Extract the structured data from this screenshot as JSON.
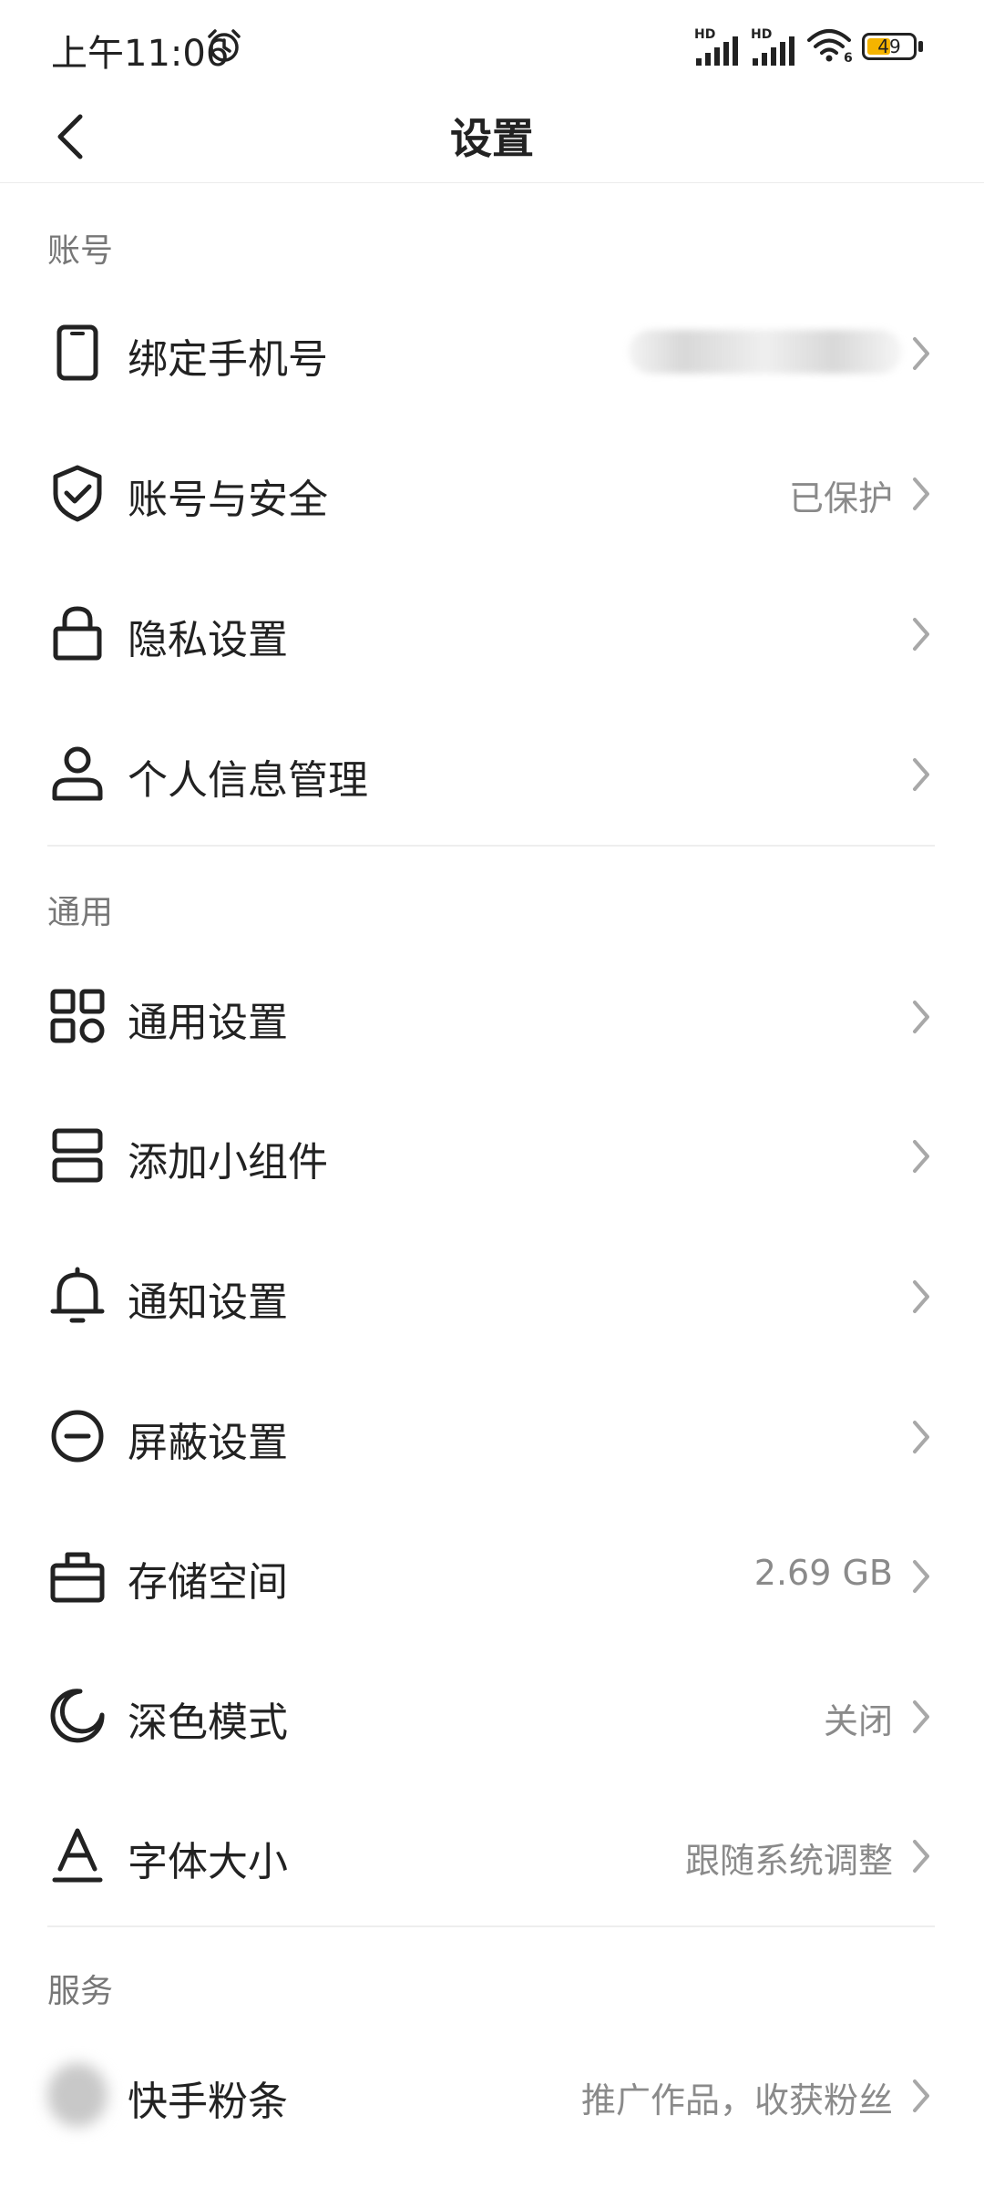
{
  "status_bar": {
    "time": "上午11:06",
    "signal_1_label": "HD",
    "signal_2_label": "HD",
    "wifi_label": "6",
    "battery_level": "49"
  },
  "header": {
    "title": "设置"
  },
  "sections": {
    "account": {
      "title": "账号",
      "items": [
        {
          "label": "绑定手机号",
          "value": "",
          "icon": "phone-icon"
        },
        {
          "label": "账号与安全",
          "value": "已保护",
          "icon": "shield-check-icon"
        },
        {
          "label": "隐私设置",
          "value": "",
          "icon": "lock-icon"
        },
        {
          "label": "个人信息管理",
          "value": "",
          "icon": "person-icon"
        }
      ]
    },
    "general": {
      "title": "通用",
      "items": [
        {
          "label": "通用设置",
          "value": "",
          "icon": "grid-icon"
        },
        {
          "label": "添加小组件",
          "value": "",
          "icon": "widget-icon"
        },
        {
          "label": "通知设置",
          "value": "",
          "icon": "bell-icon"
        },
        {
          "label": "屏蔽设置",
          "value": "",
          "icon": "block-icon"
        },
        {
          "label": "存储空间",
          "value": "2.69 GB",
          "icon": "storage-box-icon"
        },
        {
          "label": "深色模式",
          "value": "关闭",
          "icon": "moon-icon"
        },
        {
          "label": "字体大小",
          "value": "跟随系统调整",
          "icon": "font-size-icon"
        }
      ]
    },
    "services": {
      "title": "服务",
      "items": [
        {
          "label": "快手粉条",
          "value": "推广作品，收获粉丝",
          "icon": "kuaishou-fentiao-icon"
        }
      ]
    }
  },
  "colors": {
    "text_primary": "#222222",
    "text_secondary": "#8a8a8a",
    "section_header": "#777777",
    "divider": "#eeeeee",
    "battery_fill": "#f5b400"
  }
}
